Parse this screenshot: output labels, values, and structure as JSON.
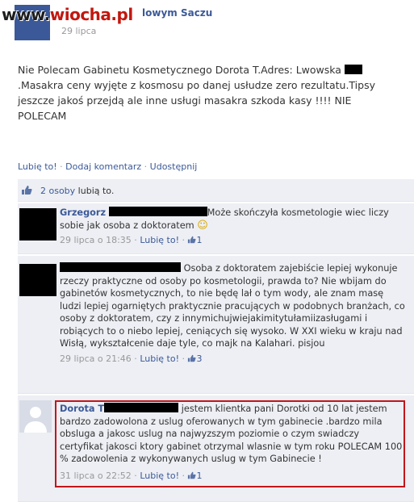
{
  "header": {
    "page_name": "Wiadomości Nowym Saczu",
    "page_name_visible": "lowym Saczu",
    "date": "29 lipca",
    "watermark": {
      "www": "www.",
      "site": "wiocha.pl"
    }
  },
  "post": {
    "text_parts": [
      "Nie Polecam Gabinetu Kosmetycznego Dorota T.Adres: Lwowska ",
      ".Masakra ceny wyjęte z kosmosu po danej usłudze zero rezultatu.Tipsy jeszcze jakoś przejdą ale inne usługi masakra szkoda kasy !!!! NIE POLECAM"
    ]
  },
  "actions": {
    "like": "Lubię to!",
    "comment": "Dodaj komentarz",
    "share": "Udostępnij",
    "separator": " · "
  },
  "likes": {
    "count_text": "2 osoby",
    "suffix": " lubią to."
  },
  "comments": [
    {
      "author": "Grzegorz",
      "text": "Może skończyła kosmetologie wiec liczy sobie jak osoba z doktoratem",
      "emoji": "☺",
      "date": "29 lipca o 18:35",
      "like_label": "Lubię to!",
      "like_count": "1"
    },
    {
      "author": "",
      "text": "Osoba z doktoratem zajebiście lepiej wykonuje rzeczy praktyczne od osoby po kosmetologii, prawda to? Nie wbijam do gabinetów kosmetycznych, to nie będę lał o tym wody, ale znam masę ludzi lepiej ogarniętych praktycznie pracujących w podobnych branżach, co osoby z doktoratem, czy z innymichujwiejakimitytułamiizasługami i robiących to o niebo lepiej, ceniących się wysoko. W XXI wieku w kraju nad Wisłą, wykształcenie daje tyle, co majk na Kalahari. pisjou",
      "date": "29 lipca o 21:46",
      "like_label": "Lubię to!",
      "like_count": "3"
    },
    {
      "author": "Dorota T",
      "text": "jestem klientka pani Dorotki od 10 lat jestem bardzo zadowolona z uslug oferowanych w tym gabinecie .bardzo mila obsluga a jakosc uslug na najwyzszym poziomie o czym swiadczy certyfikat jakosci ktory gabinet otrzymal wlasnie w tym roku POLECAM 100 % zadowolenia z wykonywanych uslug w tym Gabinecie !",
      "date": "31 lipca o 22:52",
      "like_label": "Lubię to!",
      "like_count": "1"
    }
  ],
  "colors": {
    "link": "#3b5998",
    "comment_bg": "#edeff4",
    "highlight": "#c0161b",
    "watermark": "#c2170f"
  }
}
